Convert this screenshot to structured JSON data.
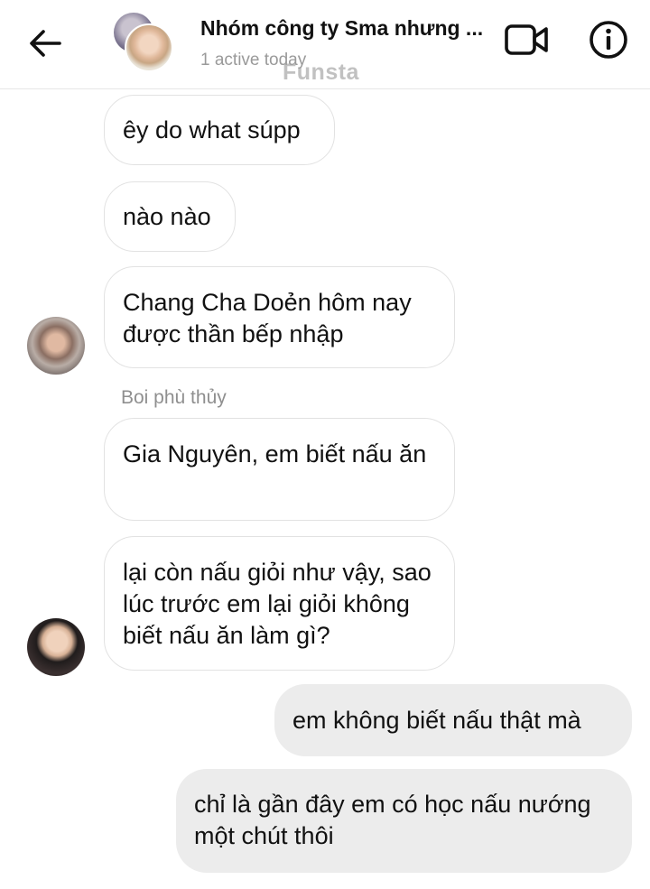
{
  "header": {
    "title": "Nhóm công ty Sma nhưng ...",
    "status": "1 active today",
    "watermark": "Funsta",
    "back_icon": "arrow-left-icon",
    "video_icon": "video-camera-icon",
    "info_icon": "info-icon"
  },
  "messages": [
    {
      "direction": "incoming",
      "text": "êy do what súpp"
    },
    {
      "direction": "incoming",
      "text": "nào nào"
    },
    {
      "direction": "incoming",
      "text": "Chang Cha Doẻn hôm nay được thần bếp nhập"
    },
    {
      "direction": "incoming",
      "sender": "Boi phù thủy",
      "text": "Gia Nguyên, em biết nấu ăn"
    },
    {
      "direction": "incoming",
      "text": "lại còn nấu giỏi như vậy, sao lúc trước em lại giỏi không biết nấu ăn làm gì?"
    },
    {
      "direction": "outgoing",
      "text": "em không biết nấu thật mà"
    },
    {
      "direction": "outgoing",
      "text": "chỉ là gần đây em có học nấu nướng một chút thôi"
    }
  ],
  "colors": {
    "incoming_border": "#e2e2e2",
    "outgoing_bg": "#ececec",
    "secondary_text": "#9a9a9a"
  }
}
